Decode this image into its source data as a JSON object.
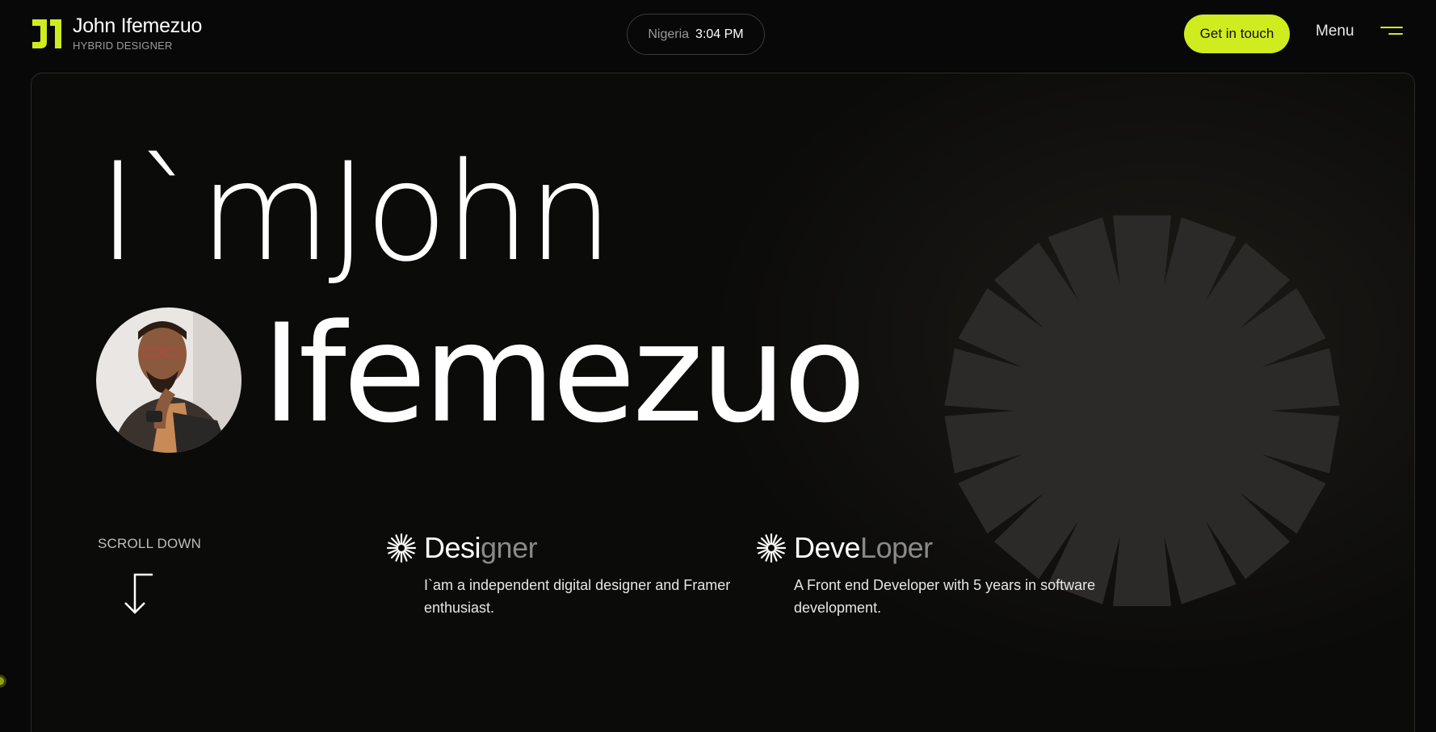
{
  "header": {
    "brand_name": "John Ifemezuo",
    "brand_subtitle": "HYBRID DESIGNER",
    "clock_country": "Nigeria",
    "clock_time": "3:04 PM",
    "cta_label": "Get in touch",
    "menu_label": "Menu"
  },
  "hero": {
    "headline_line1": "I`mJohn",
    "headline_line2": "Ifemezuo",
    "scroll_label": "SCROLL DOWN"
  },
  "roles": [
    {
      "title_strong": "Desi",
      "title_muted": "gner",
      "description": "I`am a independent digital designer and Framer enthusiast."
    },
    {
      "title_strong": "Deve",
      "title_muted": "Loper",
      "description": "A Front end Developer with 5 years in software development."
    }
  ],
  "colors": {
    "accent": "#cfec1f",
    "background": "#080808",
    "muted_text": "#8a8a8a"
  },
  "icons": [
    "logo-icon",
    "hamburger-icon",
    "starburst-icon",
    "arrow-down-icon"
  ]
}
